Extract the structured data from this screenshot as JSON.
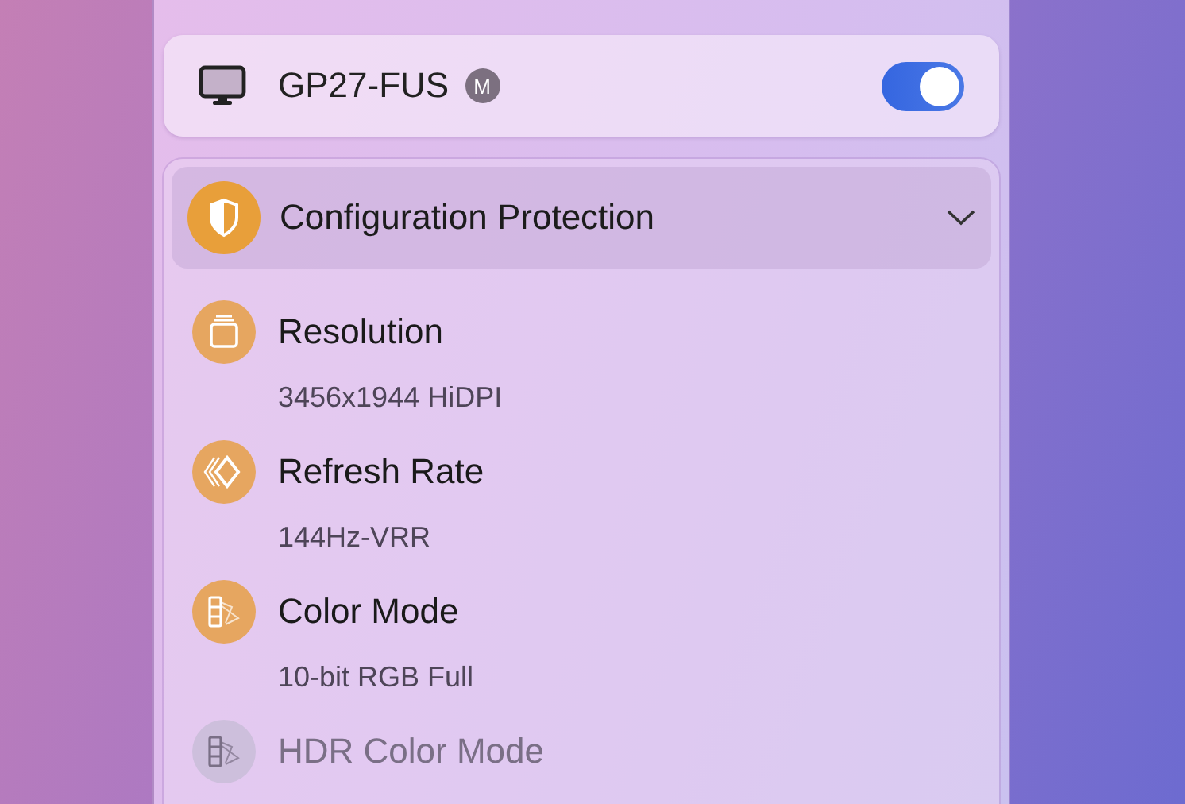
{
  "device": {
    "name": "GP27-FUS",
    "badge": "M",
    "on": true
  },
  "section": {
    "title": "Configuration Protection",
    "expanded": true,
    "items": [
      {
        "label": "Resolution",
        "value": "3456x1944 HiDPI",
        "disabled": false
      },
      {
        "label": "Refresh Rate",
        "value": "144Hz-VRR",
        "disabled": false
      },
      {
        "label": "Color Mode",
        "value": "10-bit RGB Full",
        "disabled": false
      },
      {
        "label": "HDR Color Mode",
        "disabled": true
      }
    ]
  }
}
